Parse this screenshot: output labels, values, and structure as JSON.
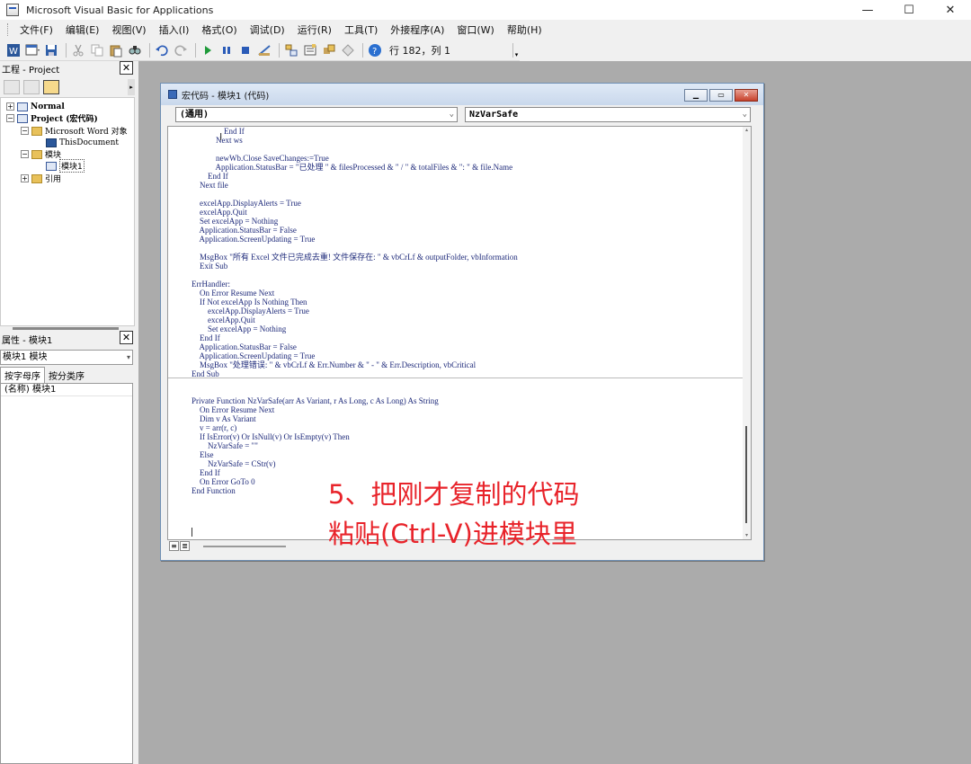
{
  "window": {
    "title": "Microsoft Visual Basic for Applications",
    "minimize": "—",
    "maximize": "☐",
    "close": "✕"
  },
  "menu": [
    "文件(F)",
    "编辑(E)",
    "视图(V)",
    "插入(I)",
    "格式(O)",
    "调试(D)",
    "运行(R)",
    "工具(T)",
    "外接程序(A)",
    "窗口(W)",
    "帮助(H)"
  ],
  "toolbar": {
    "position": "行 182，列 1",
    "icons": [
      "view-word-icon",
      "insert-userform-icon",
      "save-icon",
      "cut-icon",
      "copy-icon",
      "paste-icon",
      "find-icon",
      "undo-icon",
      "redo-icon",
      "run-icon",
      "break-icon",
      "reset-icon",
      "design-mode-icon",
      "project-explorer-icon",
      "properties-window-icon",
      "object-browser-icon",
      "toolbox-icon",
      "help-icon"
    ]
  },
  "project": {
    "title": "工程 - Project",
    "tree": [
      {
        "label": "Normal",
        "level": 0,
        "expander": "+",
        "icon": "project-icon",
        "style": "bold"
      },
      {
        "label": "Project (宏代码)",
        "level": 0,
        "expander": "−",
        "icon": "project-icon",
        "style": "bold"
      },
      {
        "label": "Microsoft Word 对象",
        "level": 1,
        "expander": "−",
        "icon": "folder-icon",
        "style": "mono"
      },
      {
        "label": "ThisDocument",
        "level": 2,
        "expander": "",
        "icon": "document-icon",
        "style": "mono"
      },
      {
        "label": "模块",
        "level": 1,
        "expander": "−",
        "icon": "folder-icon",
        "style": ""
      },
      {
        "label": "模块1",
        "level": 2,
        "expander": "",
        "icon": "module-icon",
        "style": "selected"
      },
      {
        "label": "引用",
        "level": 1,
        "expander": "+",
        "icon": "folder-icon",
        "style": ""
      }
    ]
  },
  "properties": {
    "title": "属性 - 模块1",
    "object": "模块1 模块",
    "tabs": [
      "按字母序",
      "按分类序"
    ],
    "rows": [
      "(名称) 模块1"
    ]
  },
  "code_window": {
    "title": "宏代码 - 模块1 (代码)",
    "object_combo": "(通用)",
    "proc_combo": "NzVarSafe",
    "lines": [
      "                End If",
      "            Next ws",
      "",
      "            newWb.Close SaveChanges:=True",
      "            Application.StatusBar = \"已处理 \" & filesProcessed & \" / \" & totalFiles & \": \" & file.Name",
      "        End If",
      "    Next file",
      "",
      "    excelApp.DisplayAlerts = True",
      "    excelApp.Quit",
      "    Set excelApp = Nothing",
      "    Application.StatusBar = False",
      "    Application.ScreenUpdating = True",
      "",
      "    MsgBox \"所有 Excel 文件已完成去重! 文件保存在: \" & vbCrLf & outputFolder, vbInformation",
      "    Exit Sub",
      "",
      "ErrHandler:",
      "    On Error Resume Next",
      "    If Not excelApp Is Nothing Then",
      "        excelApp.DisplayAlerts = True",
      "        excelApp.Quit",
      "        Set excelApp = Nothing",
      "    End If",
      "    Application.StatusBar = False",
      "    Application.ScreenUpdating = True",
      "    MsgBox \"处理错误: \" & vbCrLf & Err.Number & \" - \" & Err.Description, vbCritical",
      "End Sub",
      "",
      "",
      "Private Function NzVarSafe(arr As Variant, r As Long, c As Long) As String",
      "    On Error Resume Next",
      "    Dim v As Variant",
      "    v = arr(r, c)",
      "    If IsError(v) Or IsNull(v) Or IsEmpty(v) Then",
      "        NzVarSafe = \"\"",
      "    Else",
      "        NzVarSafe = CStr(v)",
      "    End If",
      "    On Error GoTo 0",
      "End Function"
    ]
  },
  "overlay": {
    "line1": "5、把刚才复制的代码",
    "line2": "粘贴(Ctrl-V)进模块里",
    "color": "#e8232a"
  }
}
